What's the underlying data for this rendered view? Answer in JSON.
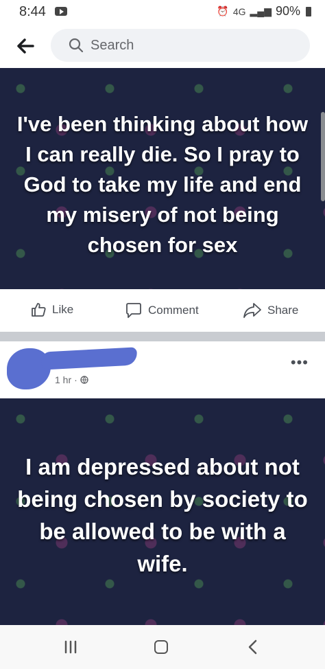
{
  "status_bar": {
    "time": "8:44",
    "network": "4G",
    "battery": "90%"
  },
  "search": {
    "placeholder": "Search"
  },
  "posts": [
    {
      "image_text": "I've been thinking about how I can really die. So I pray to God to take my life and end my misery of not being chosen for sex"
    },
    {
      "meta": "1 hr",
      "image_text": "I am depressed about not being chosen by society to be allowed to be with a wife."
    }
  ],
  "actions": {
    "like": "Like",
    "comment": "Comment",
    "share": "Share"
  },
  "colors": {
    "post_background": "#1d2340",
    "redaction": "#5a6fd0",
    "action_text": "#4b4f56"
  },
  "icons": [
    "back-arrow-icon",
    "search-icon",
    "like-icon",
    "comment-icon",
    "share-icon",
    "globe-icon",
    "more-icon",
    "nav-recents-icon",
    "nav-home-icon",
    "nav-back-icon"
  ]
}
